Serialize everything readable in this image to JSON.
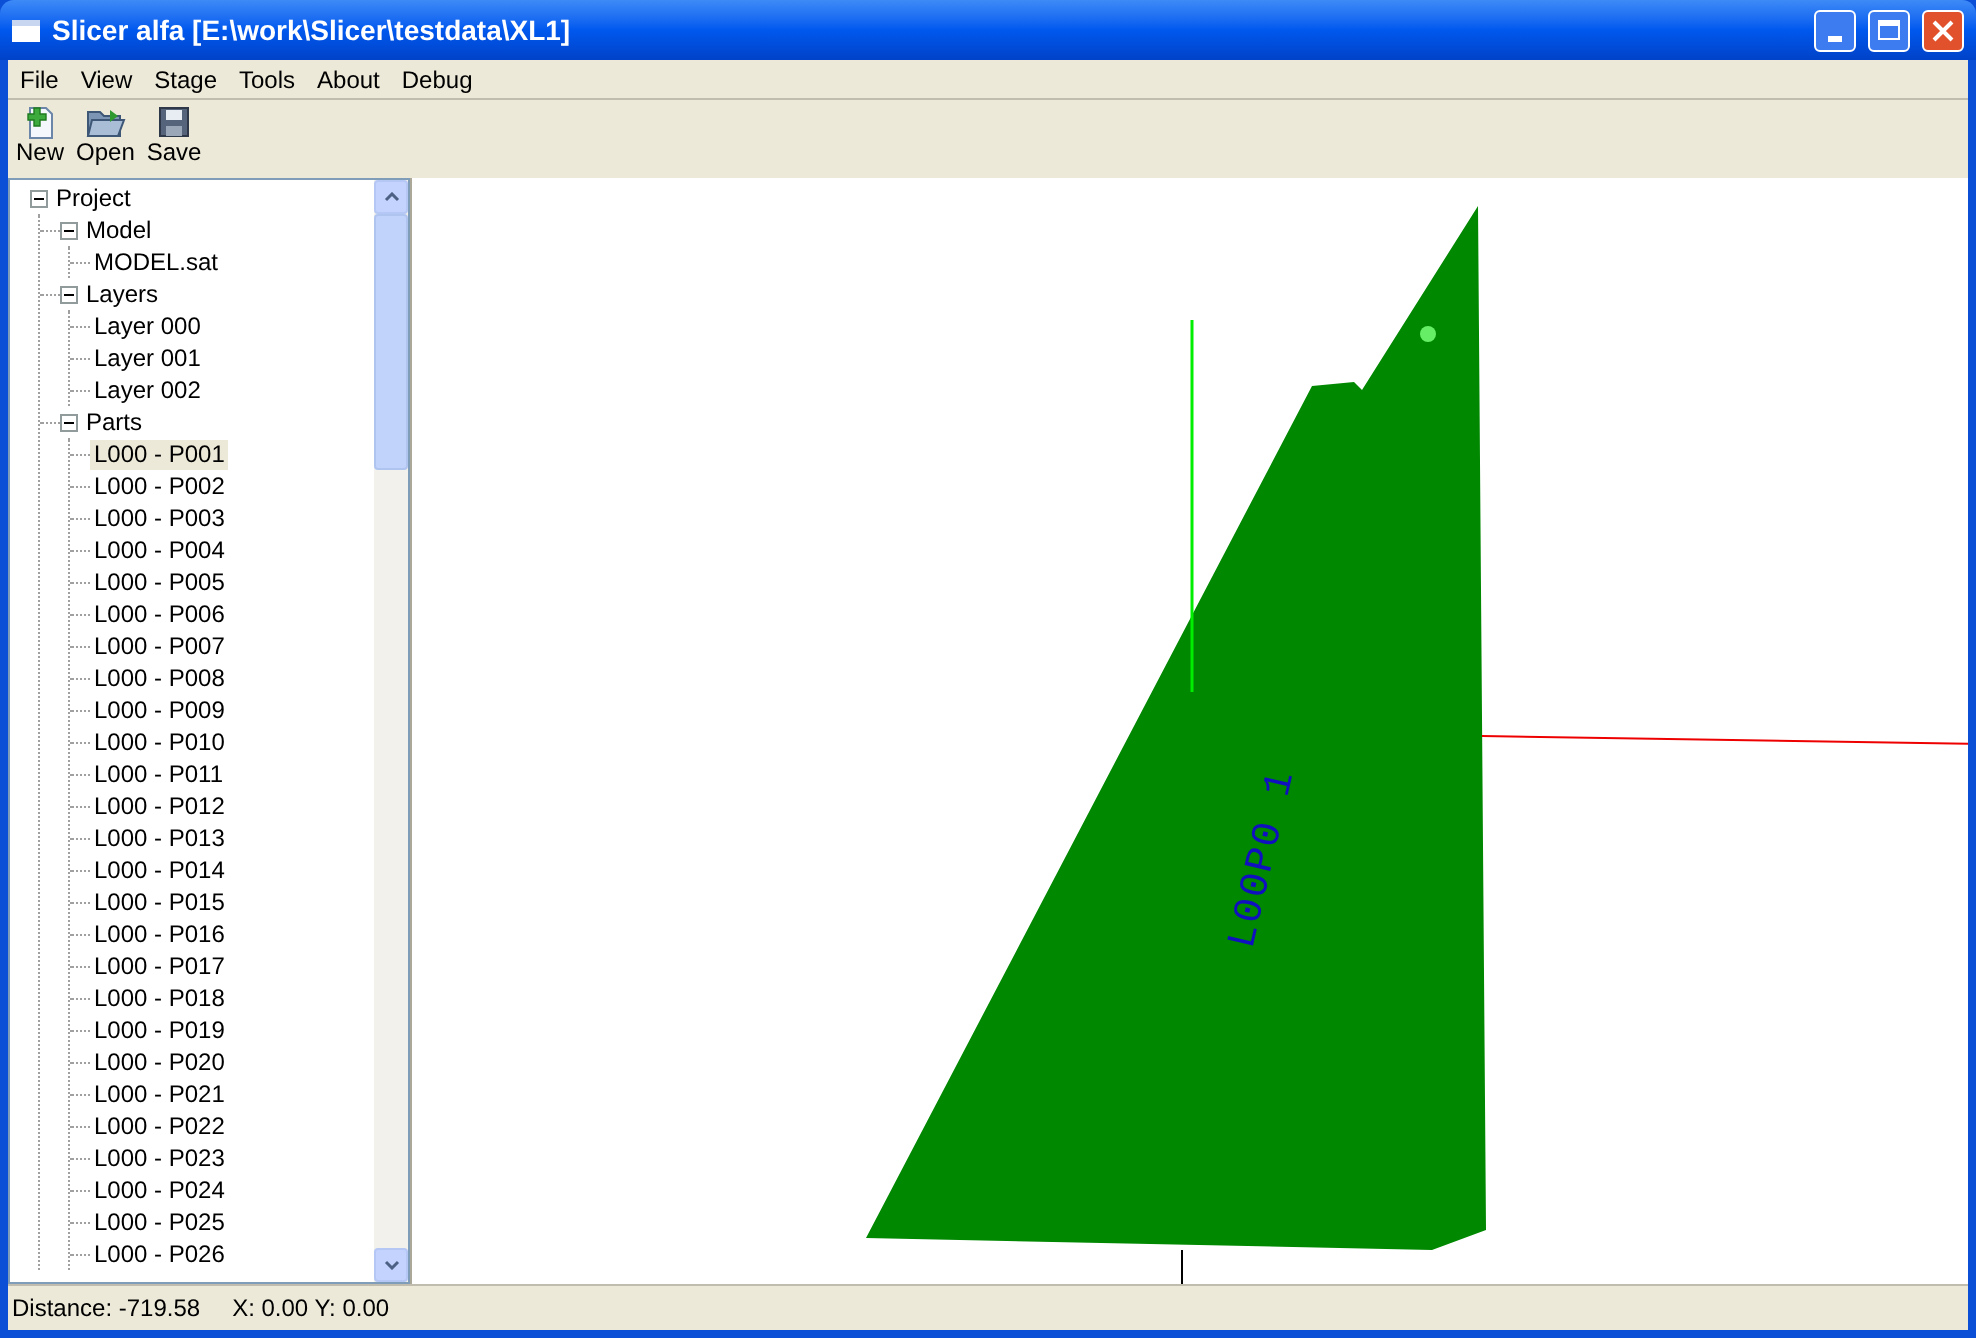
{
  "window": {
    "title": "Slicer alfa [E:\\work\\Slicer\\testdata\\XL1]"
  },
  "menu": [
    "File",
    "View",
    "Stage",
    "Tools",
    "About",
    "Debug"
  ],
  "toolbar": [
    {
      "kind": "new",
      "label": "New"
    },
    {
      "kind": "open",
      "label": "Open"
    },
    {
      "kind": "save",
      "label": "Save"
    }
  ],
  "tree": [
    {
      "label": "Project",
      "expanded": true,
      "selected": false,
      "children": [
        {
          "label": "Model",
          "expanded": true,
          "selected": false,
          "children": [
            {
              "label": "MODEL.sat",
              "selected": false
            }
          ]
        },
        {
          "label": "Layers",
          "expanded": true,
          "selected": false,
          "children": [
            {
              "label": "Layer 000",
              "selected": false
            },
            {
              "label": "Layer 001",
              "selected": false
            },
            {
              "label": "Layer 002",
              "selected": false
            }
          ]
        },
        {
          "label": "Parts",
          "expanded": true,
          "selected": false,
          "children": [
            {
              "label": "L000 - P001",
              "selected": true
            },
            {
              "label": "L000 - P002",
              "selected": false
            },
            {
              "label": "L000 - P003",
              "selected": false
            },
            {
              "label": "L000 - P004",
              "selected": false
            },
            {
              "label": "L000 - P005",
              "selected": false
            },
            {
              "label": "L000 - P006",
              "selected": false
            },
            {
              "label": "L000 - P007",
              "selected": false
            },
            {
              "label": "L000 - P008",
              "selected": false
            },
            {
              "label": "L000 - P009",
              "selected": false
            },
            {
              "label": "L000 - P010",
              "selected": false
            },
            {
              "label": "L000 - P011",
              "selected": false
            },
            {
              "label": "L000 - P012",
              "selected": false
            },
            {
              "label": "L000 - P013",
              "selected": false
            },
            {
              "label": "L000 - P014",
              "selected": false
            },
            {
              "label": "L000 - P015",
              "selected": false
            },
            {
              "label": "L000 - P016",
              "selected": false
            },
            {
              "label": "L000 - P017",
              "selected": false
            },
            {
              "label": "L000 - P018",
              "selected": false
            },
            {
              "label": "L000 - P019",
              "selected": false
            },
            {
              "label": "L000 - P020",
              "selected": false
            },
            {
              "label": "L000 - P021",
              "selected": false
            },
            {
              "label": "L000 - P022",
              "selected": false
            },
            {
              "label": "L000 - P023",
              "selected": false
            },
            {
              "label": "L000 - P024",
              "selected": false
            },
            {
              "label": "L000 - P025",
              "selected": false
            },
            {
              "label": "L000 - P026",
              "selected": false
            }
          ]
        }
      ]
    }
  ],
  "viewport": {
    "part_label": "L00P0 1"
  },
  "status_bar": [
    "Distance: -719.58",
    "X: 0.00 Y: 0.00"
  ]
}
